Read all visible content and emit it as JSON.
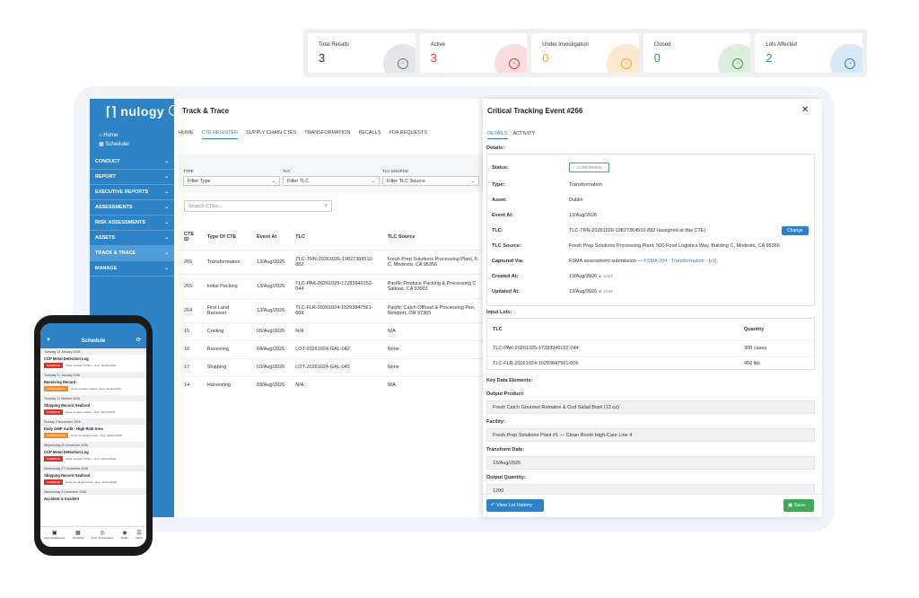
{
  "stats": [
    {
      "label": "Total Recalls",
      "value": "3",
      "color": "#333333",
      "circle": "#e4e6ea",
      "icon": "#777777"
    },
    {
      "label": "Active",
      "value": "3",
      "color": "#e53935",
      "circle": "#f9dede",
      "icon": "#e53935"
    },
    {
      "label": "Under Investigation",
      "value": "0",
      "color": "#f5a623",
      "circle": "#fde8d2",
      "icon": "#f5a623"
    },
    {
      "label": "Closed",
      "value": "0",
      "color": "#43a047",
      "circle": "#dcefdc",
      "icon": "#43a047"
    },
    {
      "label": "Lots Affected",
      "value": "2",
      "color": "#2d83c5",
      "circle": "#d8e8f6",
      "icon": "#2d83c5"
    }
  ],
  "brand": "nulogy",
  "nav_top": [
    "Home",
    "Scheduler"
  ],
  "menu": [
    "CONDUCT",
    "REPORT",
    "EXECUTIVE REPORTS",
    "ASSESSMENTS",
    "RISK ASSESSMENTS",
    "ASSETS",
    "TRACK & TRACE",
    "MANAGE"
  ],
  "page_title": "Track & Trace",
  "tabs": [
    "HOME",
    "CTE REGISTER",
    "SUPPLY CHAIN CTES",
    "TRANSFORMATION",
    "RECALLS",
    "FDA REQUESTS"
  ],
  "filters": [
    {
      "label": "TYPE",
      "value": "Filter Type"
    },
    {
      "label": "TLC",
      "value": "Filter TLC"
    },
    {
      "label": "TLC SOURCE",
      "value": "Filter TLC Source"
    }
  ],
  "search_placeholder": "Search CTEs...",
  "table": {
    "headers": [
      "CTE ID",
      "Type Of CTE",
      "Event At",
      "TLC",
      "TLC Source"
    ],
    "rows": [
      [
        "266",
        "Transformation",
        "13/Aug/2026",
        "TLC-TRN-20261026-19827364510-882",
        "Fresh Prep Solutions Processing Plant, 5",
        "C, Modesto, CA 95356"
      ],
      [
        "265",
        "Initial Packing",
        "13/Aug/2026",
        "TLC-PAK-20261025-17283940152-044",
        "Pacific Produce Packing & Processing C",
        "Salinas, CA 93901"
      ],
      [
        "264",
        "First Land Receiver",
        "13/Aug/2026",
        "TLC-FLR-20261024-10293847561-009",
        "Pacific Catch Offload & Processing Pier,",
        "Newport, OR 97365"
      ],
      [
        "15",
        "Cooling",
        "05/Aug/2026",
        "N/A",
        "N/A",
        ""
      ],
      [
        "16",
        "Receiving",
        "04/Aug/2026",
        "LOT-20261024-GAL-042",
        "None",
        ""
      ],
      [
        "17",
        "Shipping",
        "03/Aug/2026",
        "LOT-20261024-GAL-042",
        "None",
        ""
      ],
      [
        "14",
        "Harvesting",
        "03/Aug/2026",
        "N/A",
        "N/A",
        ""
      ]
    ]
  },
  "panel": {
    "title": "Critical Tracking Event #266",
    "tabs": [
      "DETAILS",
      "ACTIVITY"
    ],
    "details_label": "Details:",
    "rows": {
      "status_k": "Status:",
      "status_v": "CONFIRMED",
      "type_k": "Type:",
      "type_v": "Transformation",
      "asset_k": "Asset:",
      "asset_v": "Dublin",
      "event_k": "Event At:",
      "event_v": "13/Aug/2026",
      "tlc_k": "TLC:",
      "tlc_v": "TLC-TRN-20261026-19827364510-882 (assigned at this CTE)",
      "src_k": "TLC Source:",
      "src_v": "Fresh Prep Solutions Processing Plant, 500 Food Logistics Way, Building C, Modesto, CA 95356",
      "cap_k": "Captured Via:",
      "cap_v": "FSMA assessment submission —",
      "cap_link": "FSMA 204 - Transformation - [v1]",
      "cr_k": "Created At:",
      "cr_v": "13/Aug/2026",
      "cr_t": "at 14:57",
      "up_k": "Updated At:",
      "up_v": "13/Aug/2026",
      "up_t": "at 14:57"
    },
    "change_label": "Change",
    "input_lots_label": "Input Lots:",
    "lots_headers": [
      "TLC",
      "Quantity"
    ],
    "lots": [
      [
        "TLC-PAK-20261025-17283940152-044",
        "300 cases"
      ],
      [
        "TLC-FLR-20261024-10293847561-009",
        "450 lbs"
      ]
    ],
    "kde_label": "Key Data Elements:",
    "fields": [
      {
        "label": "Output Product:",
        "value": "Fresh Catch Gourmet Romaine & Cod Salad Bowl (12 oz)"
      },
      {
        "label": "Facility:",
        "value": "Fresh Prep Solutions Plant #1 — Clean Room High-Care Line 4"
      },
      {
        "label": "Transform Date:",
        "value": "13/Aug/2026"
      },
      {
        "label": "Output Quantity:",
        "value": "1200"
      }
    ],
    "view_btn": "View Lot History",
    "save_btn": "Save"
  },
  "phone": {
    "title": "Schedule",
    "items": [
      {
        "date": "Tuesday 13 January 2026",
        "title": "CCP Metal Detection Log",
        "tag": "OVERDUE",
        "tagcolor": "#d9342b",
        "meta": "Asset: Hudson Chilian · Due: 13/Jan/2026"
      },
      {
        "date": "Tuesday 21 January 2026",
        "title": "Receiving Record",
        "tag": "IN PROGRESS",
        "tagcolor": "#f08c2b",
        "meta": "Asset: Hudson Chilian · Due: 21/Jan/2026"
      },
      {
        "date": "Tuesday 11 October 2026",
        "title": "Shipping Record Seafood",
        "tag": "OVERDUE",
        "tagcolor": "#d9342b",
        "meta": "Asset: Hudson Chilian · Due: 11/Oct/2026"
      },
      {
        "date": "Sunday 3 November 2026",
        "title": "Daily GMP Audit - High Risk Area",
        "tag": "IN PROGRESS",
        "tagcolor": "#f08c2b",
        "meta": "Asset: Donagha Foods · Due: 03/Nov/2026"
      },
      {
        "date": "Wednesday 20 November 2026",
        "title": "CCP Metal Detection Log",
        "tag": "OVERDUE",
        "tagcolor": "#d9342b",
        "meta": "Asset: Hudson Chilian · Due: 20/Nov/2026"
      },
      {
        "date": "Wednesday 27 November 2026",
        "title": "Shipping Record Seafood",
        "tag": "OVERDUE",
        "tagcolor": "#d9342b",
        "meta": "Asset: Donagha Foods · Due: 27/Nov/2026"
      },
      {
        "date": "Wednesday 4 December 2026",
        "title": "Accident & Incident",
        "tag": "",
        "tagcolor": "#d9342b",
        "meta": ""
      }
    ],
    "nav": [
      "New Assessment",
      "Schedule",
      "Sync Conversation",
      "Radio",
      "Menu"
    ]
  }
}
